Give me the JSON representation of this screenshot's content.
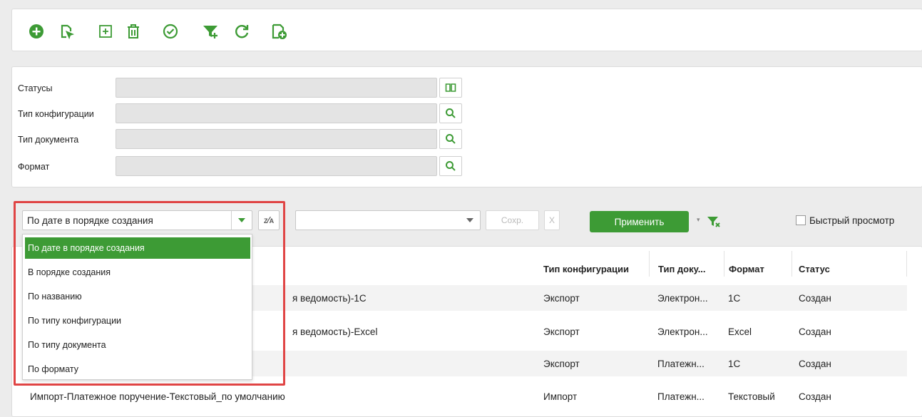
{
  "toolbar": {
    "icons": [
      "add-icon",
      "document-select-icon",
      "add-square-icon",
      "trash-icon",
      "check-circle-icon",
      "filter-add-icon",
      "refresh-icon",
      "document-add-icon"
    ]
  },
  "filters": {
    "statuses_label": "Статусы",
    "config_type_label": "Тип конфигурации",
    "doc_type_label": "Тип документа",
    "format_label": "Формат",
    "statuses_value": "",
    "config_type_value": "",
    "doc_type_value": "",
    "format_value": ""
  },
  "controls": {
    "sort_value": "По дате в порядке создания",
    "preset_value": "",
    "save_label": "Сохр.",
    "clear_label": "X",
    "apply_label": "Применить",
    "quick_view_label": "Быстрый просмотр",
    "accent_color": "#3d9b35"
  },
  "sort_options": [
    "По дате в порядке создания",
    "В порядке создания",
    "По названию",
    "По типу конфигурации",
    "По типу документа",
    "По формату"
  ],
  "table": {
    "headers": [
      "Тип конфигурации",
      "Тип доку...",
      "Формат",
      "Статус"
    ],
    "rows": [
      {
        "name": "я ведомость)-1С",
        "config": "Экспорт",
        "doc": "Электрон...",
        "format": "1С",
        "status": "Создан"
      },
      {
        "name": "я ведомость)-Excel",
        "config": "Экспорт",
        "doc": "Электрон...",
        "format": "Excel",
        "status": "Создан"
      },
      {
        "name": "",
        "config": "Экспорт",
        "doc": "Платежн...",
        "format": "1С",
        "status": "Создан"
      },
      {
        "name": "Импорт-Платежное поручение-Текстовый_по умолчанию",
        "config": "Импорт",
        "doc": "Платежн...",
        "format": "Текстовый",
        "status": "Создан"
      }
    ]
  }
}
